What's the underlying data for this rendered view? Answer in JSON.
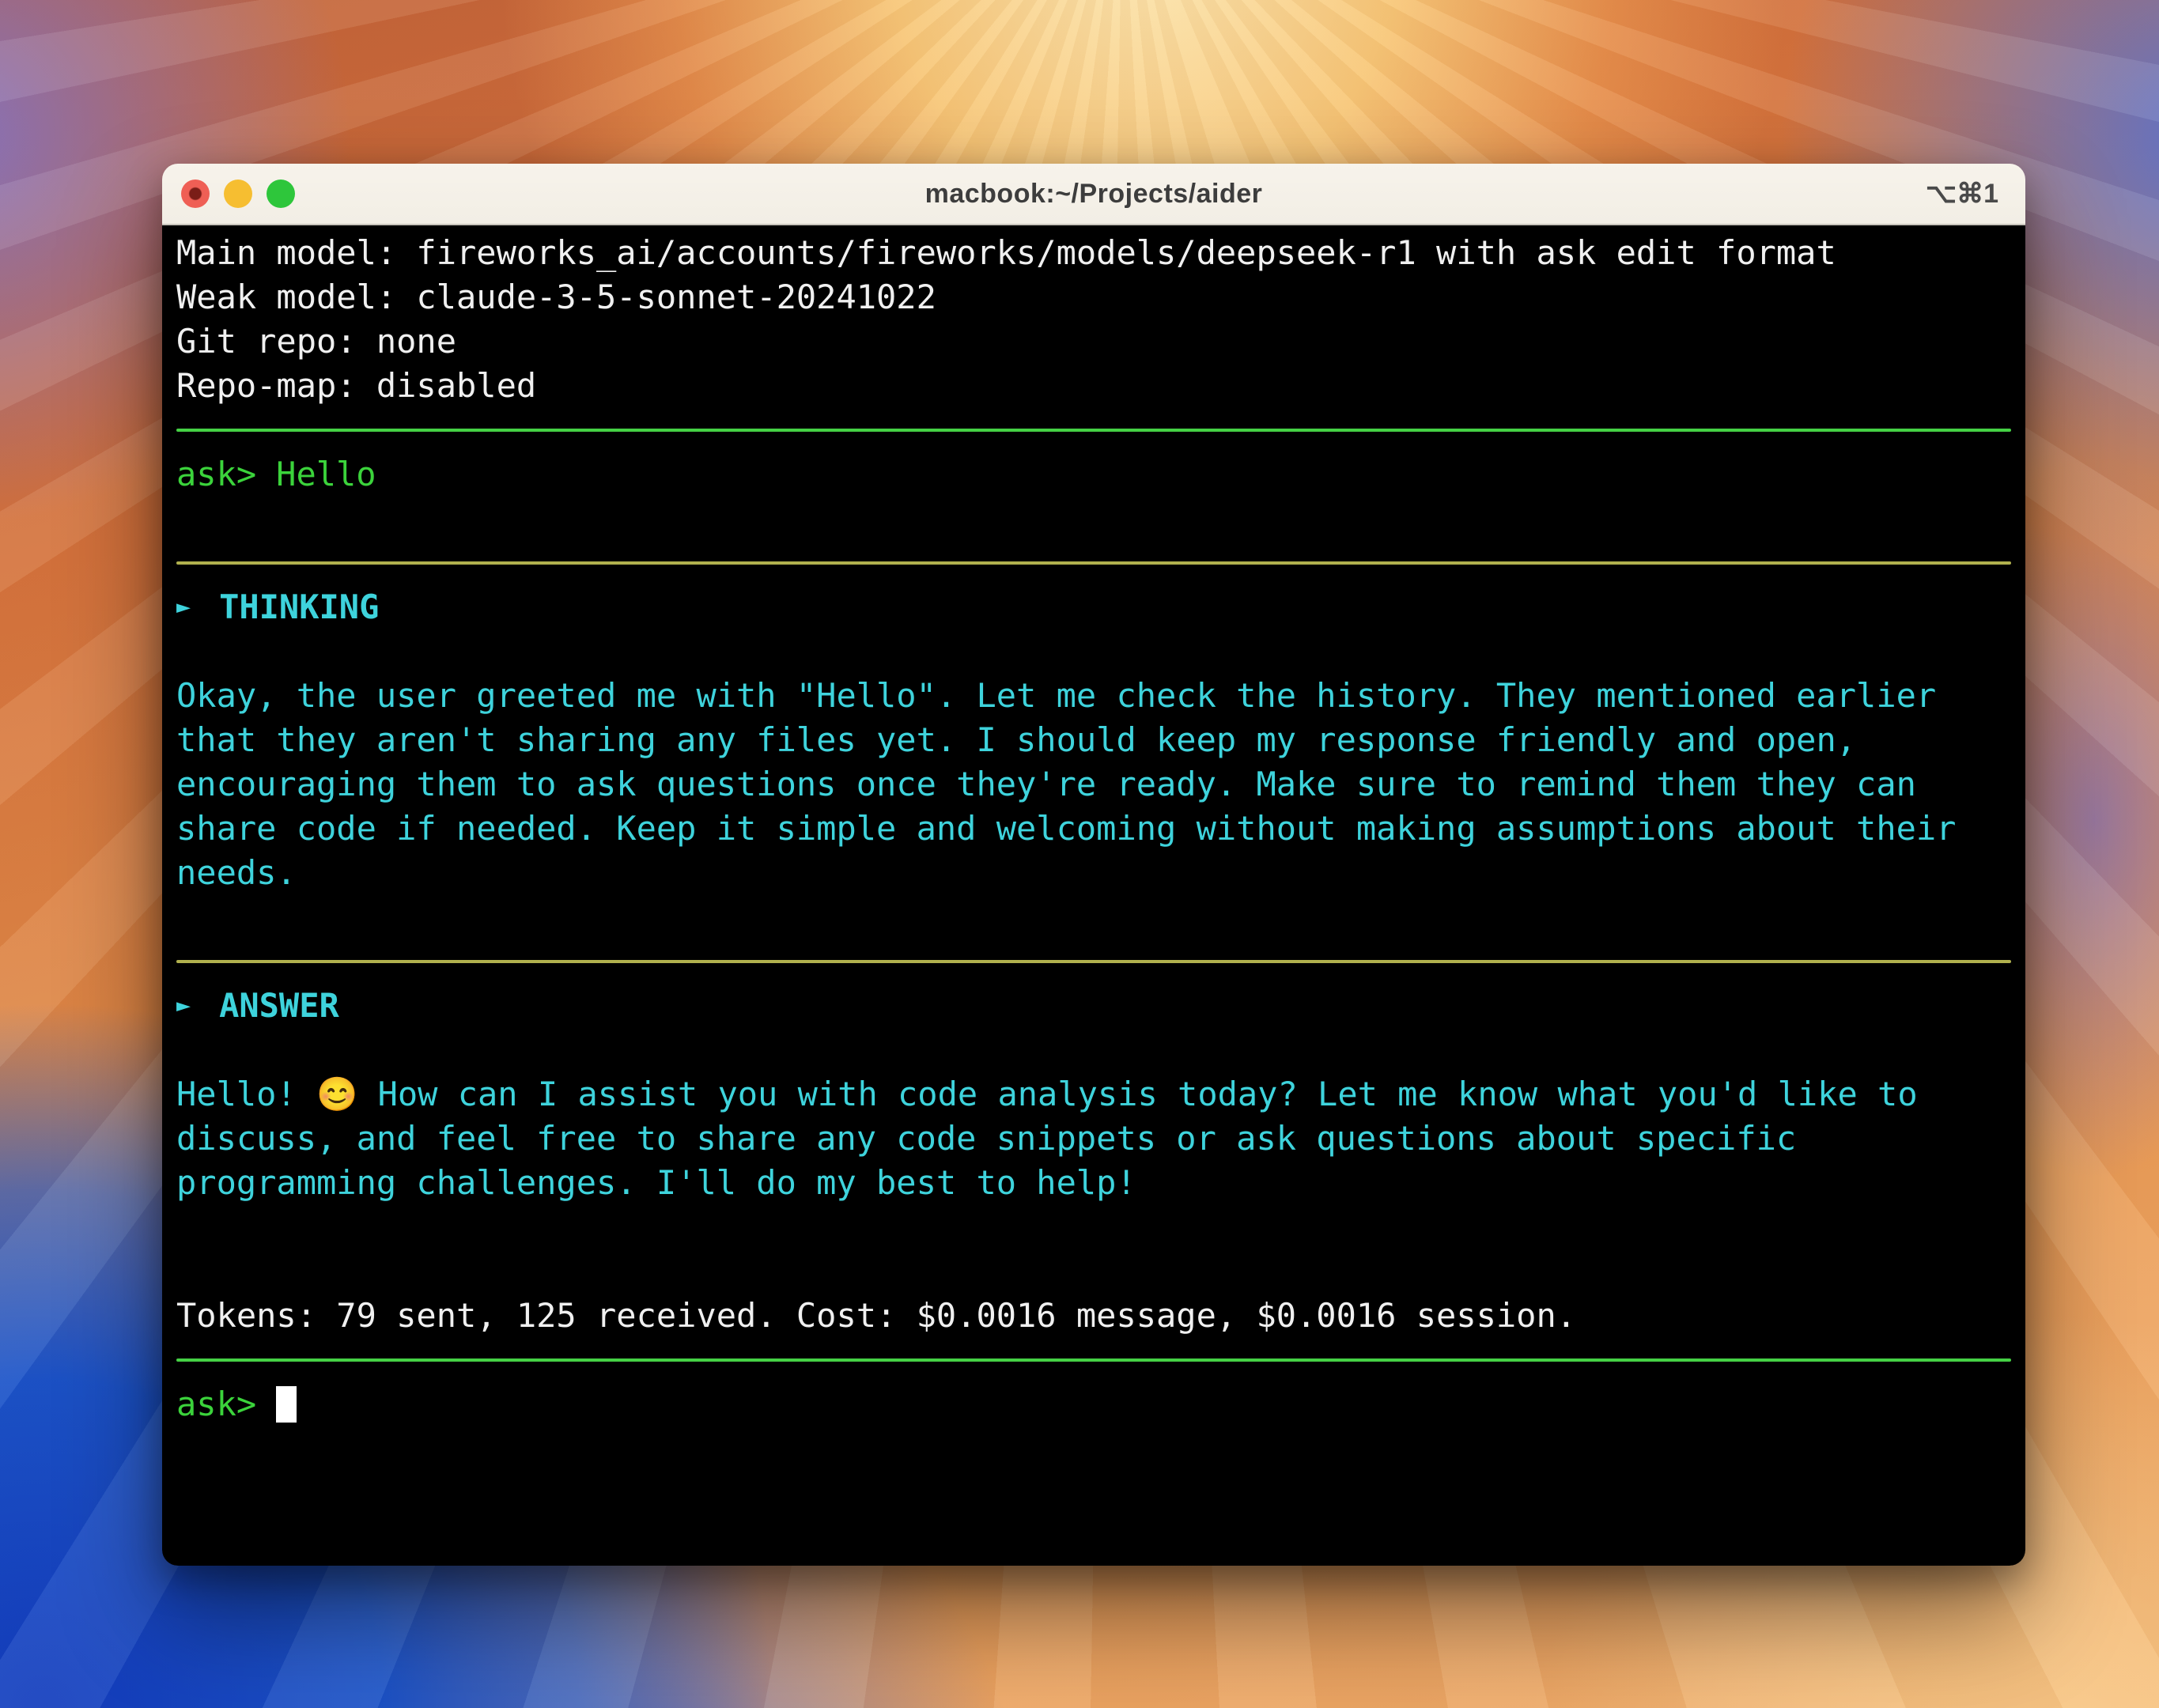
{
  "window": {
    "title": "macbook:~/Projects/aider",
    "shortcut": "⌥⌘1"
  },
  "terminal": {
    "startup_lines": [
      "Main model: fireworks_ai/accounts/fireworks/models/deepseek-r1 with ask edit format",
      "Weak model: claude-3-5-sonnet-20241022",
      "Git repo: none",
      "Repo-map: disabled"
    ],
    "prompt_label": "ask>",
    "first_prompt_input": "Hello",
    "thinking": {
      "marker": "►",
      "title": "THINKING",
      "body": "Okay, the user greeted me with \"Hello\". Let me check the history. They mentioned earlier\nthat they aren't sharing any files yet. I should keep my response friendly and open,\nencouraging them to ask questions once they're ready. Make sure to remind them they can\nshare code if needed. Keep it simple and welcoming without making assumptions about their\nneeds."
    },
    "answer": {
      "marker": "►",
      "title": "ANSWER",
      "body": "Hello! 😊 How can I assist you with code analysis today? Let me know what you'd like to\ndiscuss, and feel free to share any code snippets or ask questions about specific\nprogramming challenges. I'll do my best to help!"
    },
    "stats_line": "Tokens: 79 sent, 125 received. Cost: $0.0016 message, $0.0016 session.",
    "colors": {
      "prompt_green": "#3bd33b",
      "rule_green": "#45d145",
      "rule_yellow": "#b1b14e",
      "cyan": "#3ed3dc",
      "foreground": "#f0f0f0",
      "background": "#000000"
    }
  }
}
